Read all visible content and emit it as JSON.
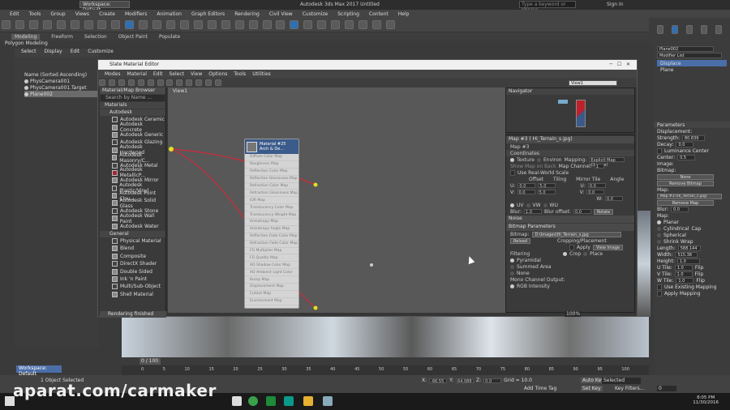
{
  "app": {
    "workspace": "Workspace: Default",
    "title": "Autodesk 3ds Max 2017   Untitled",
    "search_placeholder": "Type a keyword or phrase",
    "sign_in": "Sign In"
  },
  "menubar": [
    "Edit",
    "Tools",
    "Group",
    "Views",
    "Create",
    "Modifiers",
    "Animation",
    "Graph Editors",
    "Rendering",
    "Civil View",
    "Customize",
    "Scripting",
    "Content",
    "Help"
  ],
  "ribbon": {
    "tabs": [
      "Modeling",
      "Freeform",
      "Selection",
      "Object Paint",
      "Populate"
    ],
    "active": "Modeling",
    "sub": "Polygon Modeling"
  },
  "scene_explorer": {
    "menus": [
      "Select",
      "Display",
      "Edit",
      "Customize"
    ],
    "sort": "Name (Sorted Ascending)",
    "items": [
      "PhysCamera001",
      "PhysCamera001.Target",
      "Plane002"
    ],
    "selected": "Plane002"
  },
  "sme": {
    "title": "Slate Material Editor",
    "menus": [
      "Modes",
      "Material",
      "Edit",
      "Select",
      "View",
      "Options",
      "Tools",
      "Utilities"
    ],
    "browser_title": "Material/Map Browser",
    "search": "Search by Name ...",
    "group_materials": "Materials",
    "group_autodesk": "Autodesk",
    "autodesk_items": [
      "Autodesk Ceramic",
      "Autodesk Concrete",
      "Autodesk Generic",
      "Autodesk Glazing",
      "Autodesk Hardwood",
      "Autodesk Masonry/C...",
      "Autodesk Metal",
      "Autodesk MetallicP...",
      "Autodesk Mirror",
      "Autodesk Plastic/Vinyl",
      "Autodesk Point Clou...",
      "Autodesk Solid Glass",
      "Autodesk Stone",
      "Autodesk Wall Paint",
      "Autodesk Water"
    ],
    "group_general": "General",
    "general_items": [
      "Physical Material",
      "Blend",
      "Composite",
      "DirectX Shader",
      "Double Sided",
      "Ink 'n Paint",
      "Multi/Sub-Object",
      "Shell Material"
    ],
    "status": "Rendering finished",
    "view_tab": "View1",
    "view_dropdown": "View1",
    "node_title": "Material #25",
    "node_sub": "Arch & De...",
    "node_slots": [
      "Diffuse Color Map",
      "Roughness Map",
      "Reflection Color Map",
      "Reflection Glossiness Map",
      "Refraction Color Map",
      "Refraction Glossiness Map",
      "IOR Map",
      "Translucency Color Map",
      "Translucency Weight Map",
      "Anisotropy Map",
      "Anisotropy Angle Map",
      "Reflection Fade Color Map",
      "Refraction Fade Color Map",
      "FG Multiplier Map",
      "FG Quality Map",
      "AO Shadow Color Map",
      "AO Ambient Light Color",
      "Bump Map",
      "Displacement Map",
      "Cutout Map",
      "Environment Map"
    ],
    "navigator": "Navigator",
    "map_title": "Map #3  ( Hi_Terrain_s.jpg)",
    "map_sub": "Map #3",
    "coordinates": "Coordinates",
    "texture": "Texture",
    "environ": "Environ",
    "mapping_label": "Mapping:",
    "mapping": "Explicit Map Channel",
    "show_map": "Show Map on Back",
    "map_channel_label": "Map Channel:",
    "map_channel": "1",
    "use_real_world": "Use Real-World Scale",
    "cols": [
      "Offset",
      "Tiling",
      "Mirror Tile",
      "Angle"
    ],
    "u_row": [
      "0.0",
      "5.0",
      "0.0"
    ],
    "v_row": [
      "0.0",
      "5.0",
      "0.0"
    ],
    "w_angle": "0.0",
    "uv": [
      "UV",
      "VW",
      "WU"
    ],
    "blur_label": "Blur:",
    "blur": "1.0",
    "blur_offset_label": "Blur offset:",
    "blur_offset": "0.0",
    "rotate": "Rotate",
    "noise": "Noise",
    "bitmap_params": "Bitmap Parameters",
    "bitmap_label": "Bitmap:",
    "bitmap_path": "D:\\Images\\Hi_Terrain_s.jpg",
    "reload": "Reload",
    "cropping": "Cropping/Placement",
    "apply": "Apply",
    "view_image": "View Image",
    "crop": "Crop",
    "place": "Place",
    "filtering": "Filtering",
    "pyramidal": "Pyramidal",
    "summed": "Summed Area",
    "none": "None",
    "mono": "Mono Channel Output:",
    "rgb_intensity": "RGB Intensity",
    "zoom": "100%"
  },
  "right_panel": {
    "object": "Plane002",
    "modifier_list": "Modifier List",
    "stack": [
      "Displace",
      "Plane"
    ],
    "parameters": "Parameters",
    "displacement": "Displacement:",
    "strength_label": "Strength:",
    "strength": "80.839",
    "decay_label": "Decay:",
    "decay": "0.0",
    "luminance": "Luminance Center",
    "center_label": "Center:",
    "center": "0.5",
    "image": "Image:",
    "bitmap": "Bitmap:",
    "none_btn": "None",
    "remove_bitmap": "Remove Bitmap",
    "map_label": "Map:",
    "map_name": "Map #3 (Hi_Terrain_s.jpg)",
    "remove_map": "Remove Map",
    "blur_label": "Blur:",
    "blur": "0.0",
    "map_section": "Map:",
    "planar": "Planar",
    "cylindrical": "Cylindrical",
    "cap": "Cap",
    "spherical": "Spherical",
    "shrink": "Shrink Wrap",
    "length_label": "Length:",
    "length": "588.144",
    "width_label": "Width:",
    "width": "515.38",
    "height_label": "Height:",
    "height": "1.0",
    "utile_label": "U Tile:",
    "utile": "1.0",
    "vtile_label": "V Tile:",
    "vtile": "1.0",
    "wtile_label": "W Tile:",
    "wtile": "1.0",
    "flip": "Flip",
    "use_mapping": "Use Existing Mapping",
    "apply_mapping": "Apply Mapping"
  },
  "timeline": {
    "frame": "0 / 100",
    "ticks": [
      "0",
      "5",
      "10",
      "15",
      "20",
      "25",
      "30",
      "35",
      "40",
      "45",
      "50",
      "55",
      "60",
      "65",
      "70",
      "75",
      "80",
      "85",
      "90",
      "95",
      "100"
    ]
  },
  "status": {
    "selected": "1 Object Selected",
    "x": "-66.55",
    "y": "64.088",
    "z": "0.0",
    "grid": "Grid = 10.0",
    "add_time_tag": "Add Time Tag",
    "auto_key": "Auto Key",
    "set_key": "Set Key",
    "selected_dd": "Selected",
    "key_filters": "Key Filters...",
    "frame": "0"
  },
  "taskbar": {
    "time": "8:05 PM",
    "date": "11/30/2016"
  },
  "watermark": "aparat.com/carmaker"
}
